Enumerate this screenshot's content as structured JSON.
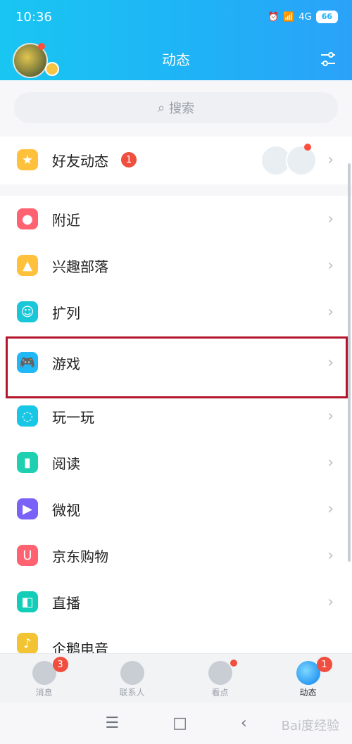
{
  "status_bar": {
    "time": "10:36",
    "signal_text": "4G",
    "battery": "66"
  },
  "header": {
    "title": "动态"
  },
  "search": {
    "placeholder": "搜索"
  },
  "friend_feed": {
    "label": "好友动态",
    "badge": "1"
  },
  "list": [
    {
      "label": "附近",
      "icon": "location-icon",
      "color": "#ff6271"
    },
    {
      "label": "兴趣部落",
      "icon": "tent-icon",
      "color": "#ffc13b"
    },
    {
      "label": "扩列",
      "icon": "smile-plus-icon",
      "color": "#19c7d8"
    },
    {
      "label": "游戏",
      "icon": "gamepad-icon",
      "color": "#20b8f7"
    },
    {
      "label": "玩一玩",
      "icon": "planet-icon",
      "color": "#17c7e5"
    },
    {
      "label": "阅读",
      "icon": "book-icon",
      "color": "#1ecfb0"
    },
    {
      "label": "微视",
      "icon": "play-icon",
      "color": "#7a61f8"
    },
    {
      "label": "京东购物",
      "icon": "bag-icon",
      "color": "#ff6271"
    },
    {
      "label": "直播",
      "icon": "live-icon",
      "color": "#12cdb8"
    },
    {
      "label": "企鹅电音",
      "icon": "music-icon",
      "color": "#f2c332"
    }
  ],
  "bottom_nav": [
    {
      "label": "消息",
      "badge": "3",
      "active": false
    },
    {
      "label": "联系人",
      "badge": "",
      "active": false
    },
    {
      "label": "看点",
      "badge": "",
      "dot": true,
      "active": false
    },
    {
      "label": "动态",
      "badge": "1",
      "active": true
    }
  ],
  "system_nav": {
    "menu": "☰",
    "home": "□",
    "back": "‹"
  },
  "watermark": "Bai度经验"
}
